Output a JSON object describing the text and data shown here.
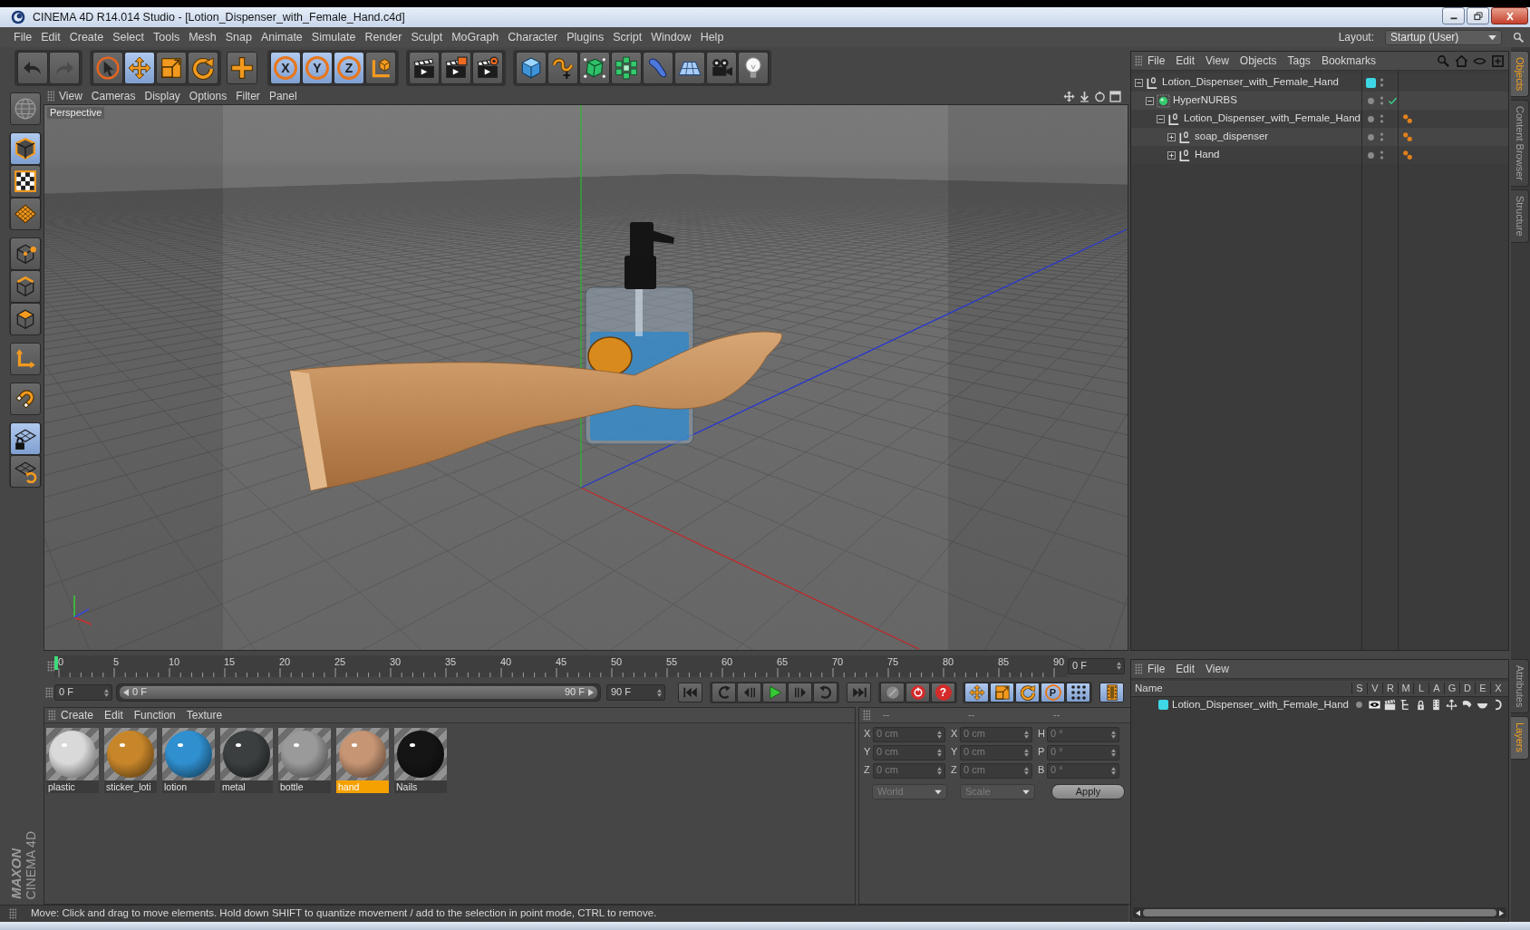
{
  "window": {
    "title": "CINEMA 4D R14.014 Studio - [Lotion_Dispenser_with_Female_Hand.c4d]"
  },
  "menu_bar": {
    "items": [
      "File",
      "Edit",
      "Create",
      "Select",
      "Tools",
      "Mesh",
      "Snap",
      "Animate",
      "Simulate",
      "Render",
      "Sculpt",
      "MoGraph",
      "Character",
      "Plugins",
      "Script",
      "Window",
      "Help"
    ],
    "layout_label": "Layout:",
    "layout_value": "Startup (User)"
  },
  "history": {
    "undo": {
      "disabled": false
    },
    "redo": {
      "disabled": true
    }
  },
  "toolbar": {
    "groups": [
      {
        "tools": [
          {
            "selected": false
          },
          {
            "selected": true
          },
          {
            "selected": false
          },
          {
            "selected": false
          }
        ]
      },
      {
        "tools": [
          {
            "selected": false
          }
        ]
      },
      {
        "tools": [
          {
            "label": "X",
            "selected": true
          },
          {
            "label": "Y",
            "selected": true
          },
          {
            "label": "Z",
            "selected": true
          },
          {
            "selected": false
          }
        ]
      },
      {
        "tools": [
          {
            "selected": false
          },
          {
            "selected": false
          },
          {
            "selected": false
          }
        ]
      },
      {
        "tools": [
          {
            "selected": false
          },
          {
            "selected": false
          },
          {
            "selected": false
          },
          {
            "selected": false
          },
          {
            "selected": false
          },
          {
            "selected": false
          },
          {
            "selected": false
          },
          {
            "selected": false
          }
        ]
      }
    ]
  },
  "mode_toolbar": [
    {
      "selected": false
    },
    {
      "selected": true
    },
    {
      "selected": false
    },
    {
      "selected": false
    },
    {
      "selected": false
    },
    {
      "selected": false
    },
    {
      "selected": false
    },
    {
      "selected": false
    },
    {
      "selected": false
    },
    {
      "selected": true
    },
    {
      "selected": false
    }
  ],
  "logo": {
    "brand": "MAXON",
    "product": "CINEMA 4D"
  },
  "viewport": {
    "menu": [
      "View",
      "Cameras",
      "Display",
      "Options",
      "Filter",
      "Panel"
    ],
    "camera": "Perspective"
  },
  "timeline": {
    "ticks": [
      "0",
      "5",
      "10",
      "15",
      "20",
      "25",
      "30",
      "35",
      "40",
      "45",
      "50",
      "55",
      "60",
      "65",
      "70",
      "75",
      "80",
      "85",
      "90"
    ],
    "playhead": {
      "level": 0
    },
    "frame_field": "0 F"
  },
  "transport": {
    "start_field": "0 F",
    "preview_range": {
      "start": "0 F",
      "end": "90 F",
      "level": 1
    },
    "end_field": "90 F",
    "groups": [
      {
        "buttons": [
          {
            "selected": false
          }
        ]
      },
      {
        "buttons": [
          {
            "selected": false
          },
          {
            "selected": false
          },
          {
            "selected": false
          },
          {
            "selected": false
          },
          {
            "selected": false
          }
        ]
      },
      {
        "buttons": [
          {
            "selected": false
          }
        ]
      },
      {
        "buttons": [
          {
            "selected": false
          },
          {
            "selected": false
          },
          {
            "label": "?",
            "selected": false
          }
        ]
      },
      {
        "buttons": [
          {
            "selected": true
          },
          {
            "selected": true
          },
          {
            "selected": true
          },
          {
            "label": "P",
            "selected": true
          },
          {
            "selected": true
          }
        ]
      },
      {
        "buttons": [
          {
            "selected": true
          }
        ]
      }
    ]
  },
  "material_manager": {
    "menu": [
      "Create",
      "Edit",
      "Function",
      "Texture"
    ],
    "materials": [
      {
        "name": "plastic",
        "color": "#d9d9d9",
        "selected": false
      },
      {
        "name": "sticker_loti",
        "color": "#c8862a",
        "selected": false
      },
      {
        "name": "lotion",
        "color": "#2f8fcf",
        "selected": false
      },
      {
        "name": "metal",
        "color": "#3b3f40",
        "selected": false
      },
      {
        "name": "bottle",
        "color": "#9a9a9a",
        "selected": false
      },
      {
        "name": "hand",
        "color": "#c69574",
        "selected": true
      },
      {
        "name": "Nails",
        "color": "#151515",
        "selected": false
      }
    ]
  },
  "coordinates": {
    "disabled": true,
    "headers": [
      "--",
      "--",
      "--"
    ],
    "rows": [
      {
        "cells": [
          {
            "axis": "X",
            "value": "0 cm"
          },
          {
            "axis": "X",
            "value": "0 cm"
          },
          {
            "axis": "H",
            "value": "0 °"
          }
        ]
      },
      {
        "cells": [
          {
            "axis": "Y",
            "value": "0 cm"
          },
          {
            "axis": "Y",
            "value": "0 cm"
          },
          {
            "axis": "P",
            "value": "0 °"
          }
        ]
      },
      {
        "cells": [
          {
            "axis": "Z",
            "value": "0 cm"
          },
          {
            "axis": "Z",
            "value": "0 cm"
          },
          {
            "axis": "B",
            "value": "0 °"
          }
        ]
      }
    ],
    "coordinate_system": "World",
    "transform_mode": "Scale",
    "apply": "Apply"
  },
  "status_bar": {
    "text": "Move: Click and drag to move elements. Hold down SHIFT to quantize movement / add to the selection in point mode, CTRL to remove."
  },
  "object_manager": {
    "menu": [
      "File",
      "Edit",
      "View",
      "Objects",
      "Tags",
      "Bookmarks"
    ],
    "tree": [
      {
        "name": "Lotion_Dispenser_with_Female_Hand",
        "kind": "null",
        "expanded": true,
        "color": "#3ed6e6",
        "children": [
          {
            "name": "HyperNURBS",
            "kind": "hypernurbs",
            "expanded": true,
            "enabled": true,
            "children": [
              {
                "name": "Lotion_Dispenser_with_Female_Hand",
                "kind": "null",
                "expanded": true,
                "tags": [
                  {
                    "kind": "texture"
                  }
                ],
                "children": [
                  {
                    "name": "soap_dispenser",
                    "kind": "null",
                    "expanded": false,
                    "tags": [
                      {
                        "kind": "texture"
                      }
                    ]
                  },
                  {
                    "name": "Hand",
                    "kind": "null",
                    "expanded": false,
                    "tags": [
                      {
                        "kind": "texture"
                      }
                    ]
                  }
                ]
              }
            ]
          }
        ]
      }
    ]
  },
  "layer_manager": {
    "menu": [
      "File",
      "Edit",
      "View"
    ],
    "columns": [
      "Name",
      "S",
      "V",
      "R",
      "M",
      "L",
      "A",
      "G",
      "D",
      "E",
      "X"
    ],
    "layers": [
      {
        "name": "Lotion_Dispenser_with_Female_Hand",
        "color": "#3ed6e6",
        "flags": [
          {
            "on": false
          },
          {
            "on": true
          },
          {
            "on": true
          },
          {
            "on": true
          },
          {
            "on": true
          },
          {
            "on": true
          },
          {
            "on": true
          },
          {
            "on": true
          },
          {
            "on": true
          },
          {
            "on": true
          }
        ]
      }
    ]
  },
  "side_tabs": {
    "top": [
      {
        "label": "Objects",
        "selected": true
      },
      {
        "label": "Content Browser",
        "selected": false
      },
      {
        "label": "Structure",
        "selected": false
      }
    ],
    "bottom": [
      {
        "label": "Attributes",
        "selected": false
      },
      {
        "label": "Layers",
        "selected": true
      }
    ]
  }
}
